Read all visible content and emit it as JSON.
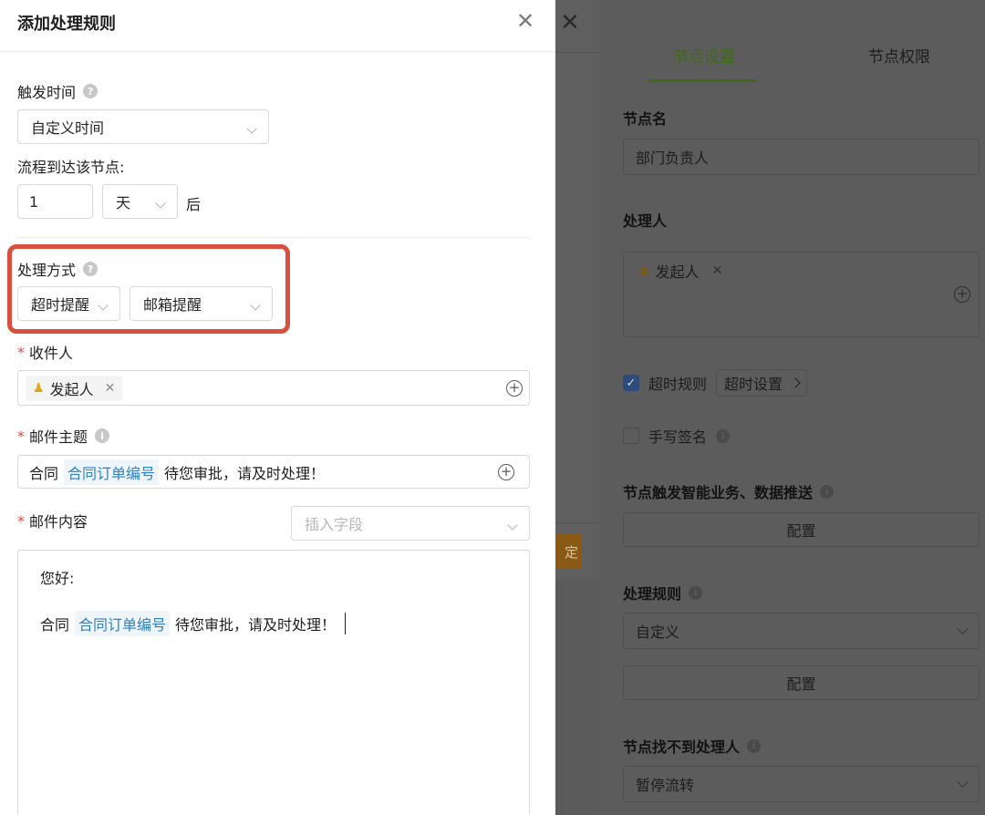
{
  "drawer": {
    "title": "添加处理规则",
    "trigger_time": {
      "label": "触发时间",
      "value": "自定义时间"
    },
    "arrival": {
      "label": "流程到达该节点:",
      "amount": "1",
      "unit": "天",
      "suffix": "后"
    },
    "method": {
      "label": "处理方式",
      "type": "超时提醒",
      "channel": "邮箱提醒"
    },
    "recipient": {
      "required_mark": "*",
      "label": "收件人",
      "tag": "发起人"
    },
    "subject": {
      "required_mark": "*",
      "label": "邮件主题",
      "prefix": "合同",
      "field": "合同订单编号",
      "suffix": "待您审批，请及时处理！"
    },
    "content": {
      "required_mark": "*",
      "label": "邮件内容",
      "insert_placeholder": "插入字段",
      "greeting": "您好:",
      "prefix": "合同",
      "field": "合同订单编号",
      "suffix": "待您审批，请及时处理！"
    }
  },
  "middle_modal": {
    "ok_label": "定"
  },
  "node_panel": {
    "tabs": [
      "节点设置",
      "节点权限"
    ],
    "node_name": {
      "label": "节点名",
      "value": "部门负责人"
    },
    "handler": {
      "label": "处理人",
      "tag": "发起人"
    },
    "timeout_rule": {
      "label": "超时规则",
      "button": "超时设置",
      "checked": true
    },
    "signature": {
      "label": "手写签名",
      "checked": false
    },
    "trigger_push": {
      "label": "节点触发智能业务、数据推送",
      "button": "配置"
    },
    "process_rule": {
      "label": "处理规则",
      "value": "自定义",
      "button": "配置"
    },
    "no_handler": {
      "label": "节点找不到处理人",
      "value": "暂停流转"
    }
  },
  "colors": {
    "accent_green": "#3f6a1a",
    "link_blue": "#2f7fcb",
    "required_red": "#e5483a",
    "highlight_red": "#d9503f",
    "ok_orange": "#8a5a14"
  }
}
